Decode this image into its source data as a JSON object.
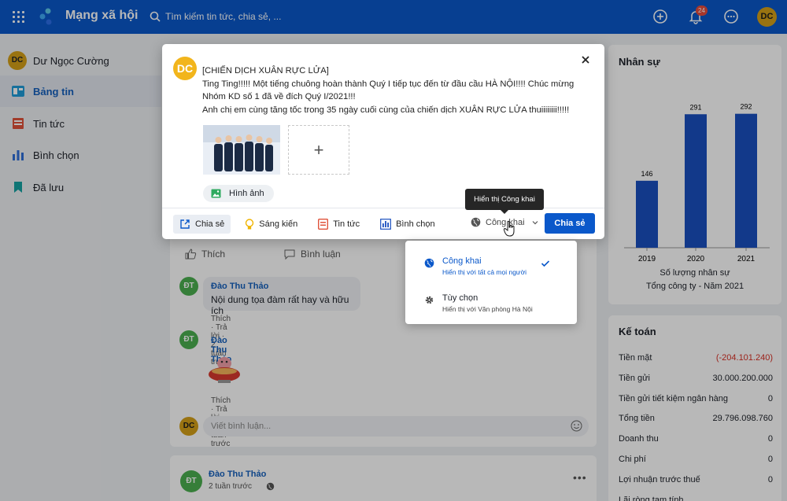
{
  "topbar": {
    "app_title": "Mạng xã hội",
    "search_placeholder": "Tìm kiếm tin tức, chia sẻ, ...",
    "notification_count": "24",
    "avatar_initials": "DC",
    "brand_color": "#0a58ca"
  },
  "left_nav": {
    "user_initials": "DC",
    "user_name": "Dư Ngọc Cường",
    "items": [
      {
        "label": "Bảng tin",
        "icon": "newsfeed-icon",
        "active": true
      },
      {
        "label": "Tin tức",
        "icon": "news-icon",
        "active": false
      },
      {
        "label": "Bình chọn",
        "icon": "poll-icon",
        "active": false
      },
      {
        "label": "Đã lưu",
        "icon": "bookmark-icon",
        "active": false
      }
    ]
  },
  "feed": {
    "like_label": "Thích",
    "comment_label": "Bình luận",
    "comments": [
      {
        "initials": "ĐT",
        "name": "Đào Thu Thảo",
        "text": "Nội dung tọa đàm rất hay và hữu ích",
        "like": "Thích",
        "reply": "Trả lời",
        "time": "2 tuần trước"
      },
      {
        "initials": "ĐT",
        "name": "Đào Thu Thảo",
        "text": "",
        "like": "Thích",
        "reply": "Trả lời",
        "time": "2 tuần trước"
      }
    ],
    "comment_placeholder": "Viết bình luận...",
    "my_initials": "DC",
    "next_post": {
      "initials": "ĐT",
      "name": "Đào Thu Thảo",
      "time": "2 tuần trước"
    }
  },
  "right": {
    "staff_title": "Nhân sự",
    "chart_caption_1": "Số lượng nhân sự",
    "chart_caption_2": "Tổng công ty - Năm 2021",
    "accounting_title": "Kế toán",
    "accounting_rows": [
      {
        "label": "Tiền mặt",
        "value": "(-204.101.240)",
        "negative": true
      },
      {
        "label": "Tiền gửi",
        "value": "30.000.200.000",
        "negative": false
      },
      {
        "label": "Tiền gửi tiết kiệm ngân hàng",
        "value": "0",
        "negative": false
      },
      {
        "label": "Tổng tiền",
        "value": "29.796.098.760",
        "negative": false
      },
      {
        "label": "Doanh thu",
        "value": "0",
        "negative": false
      },
      {
        "label": "Chi phí",
        "value": "0",
        "negative": false
      },
      {
        "label": "Lợi nhuận trước thuế",
        "value": "0",
        "negative": false
      },
      {
        "label": "Lãi ròng tạm tính",
        "value": "",
        "negative": false
      }
    ]
  },
  "chart_data": {
    "type": "bar",
    "categories": [
      "2019",
      "2020",
      "2021"
    ],
    "values": [
      146,
      291,
      292
    ],
    "title": "",
    "xlabel": "Số lượng nhân sự",
    "ylabel": "",
    "ylim": [
      0,
      300
    ],
    "bar_color": "#1a4fbf",
    "grid": false
  },
  "modal": {
    "avatar_initials": "DC",
    "post_lines": [
      "[CHIẾN DỊCH XUÂN RỰC LỬA]",
      "Ting Ting!!!!! Một tiếng chuông hoàn thành Quý I tiếp tục đến từ đầu cầu HÀ NỘI!!!! Chúc mừng",
      "Nhóm KD số 1 đã về đích Quý I/2021!!!",
      "Anh chị em cùng tăng tốc trong 35 ngày cuối cùng của chiến dịch XUÂN RỰC LỬA thuiiiiiiii!!!!!"
    ],
    "image_chip_label": "Hình ảnh",
    "tools": [
      {
        "label": "Chia sẻ",
        "icon": "share-icon",
        "active": true
      },
      {
        "label": "Sáng kiến",
        "icon": "lightbulb-icon",
        "active": false
      },
      {
        "label": "Tin tức",
        "icon": "news-icon",
        "active": false
      },
      {
        "label": "Bình chọn",
        "icon": "poll-icon",
        "active": false
      }
    ],
    "privacy_label": "Công khai",
    "submit_label": "Chia sẻ",
    "tooltip": "Hiển thị Công khai"
  },
  "privacy_dropdown": [
    {
      "title": "Công khai",
      "subtitle": "Hiển thị với tất cả mọi người",
      "icon": "globe-icon",
      "selected": true
    },
    {
      "title": "Tùy chọn",
      "subtitle": "Hiển thị với Văn phòng Hà Nội",
      "icon": "gear-icon",
      "selected": false
    }
  ]
}
